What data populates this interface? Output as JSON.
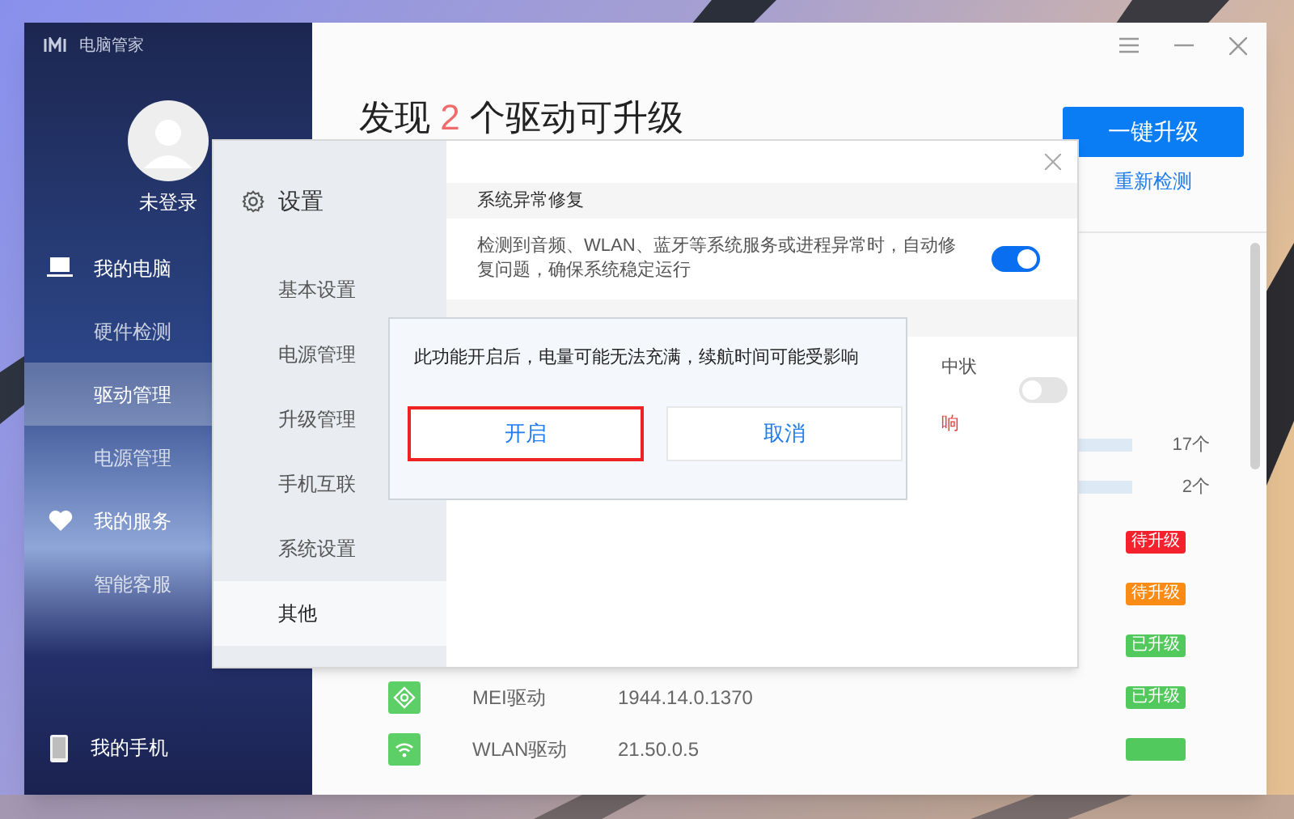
{
  "app": {
    "title": "电脑管家"
  },
  "sidebar": {
    "user": "未登录",
    "items": [
      {
        "label": "我的电脑",
        "kind": "section",
        "selected": false
      },
      {
        "label": "硬件检测",
        "kind": "item",
        "selected": false
      },
      {
        "label": "驱动管理",
        "kind": "item",
        "selected": true
      },
      {
        "label": "电源管理",
        "kind": "item",
        "selected": false
      },
      {
        "label": "我的服务",
        "kind": "section",
        "selected": false
      },
      {
        "label": "智能客服",
        "kind": "item",
        "selected": false
      }
    ],
    "bottom_item": {
      "label": "我的手机"
    }
  },
  "main": {
    "heading": {
      "before": "发现",
      "count": "2",
      "after": "个驱动可升级"
    },
    "upgrade_button": "一键升级",
    "recheck_link": "重新检测",
    "summary": [
      {
        "count": "17个"
      },
      {
        "count": "2个"
      }
    ],
    "drivers": [
      {
        "status": "待升级",
        "color": "#f5222d"
      },
      {
        "status": "待升级",
        "color": "#fa8c16"
      },
      {
        "status": "已升级",
        "color": "#52c95c"
      },
      {
        "name": "MEI驱动",
        "version": "1944.14.0.1370",
        "status": "已升级",
        "color": "#52c95c"
      },
      {
        "name": "WLAN驱动",
        "version": "21.50.0.5",
        "color": "#52c95c"
      }
    ]
  },
  "settings": {
    "title": "设置",
    "nav": [
      {
        "label": "基本设置",
        "selected": false
      },
      {
        "label": "电源管理",
        "selected": false
      },
      {
        "label": "升级管理",
        "selected": false
      },
      {
        "label": "手机互联",
        "selected": false
      },
      {
        "label": "系统设置",
        "selected": false
      },
      {
        "label": "其他",
        "selected": true
      }
    ],
    "sections": [
      {
        "kind": "full",
        "title": "系统异常修复",
        "description": "检测到音频、WLAN、蓝牙等系统服务或进程异常时，自动修复问题，确保系统稳定运行",
        "on": true
      },
      {
        "kind": "partial",
        "fragment": "中状",
        "warning": "响",
        "on": false
      }
    ]
  },
  "confirm": {
    "message": "此功能开启后，电量可能无法充满，续航时间可能受影响",
    "buttons": [
      {
        "label": "开启",
        "highlighted": true
      },
      {
        "label": "取消",
        "highlighted": false
      }
    ]
  }
}
